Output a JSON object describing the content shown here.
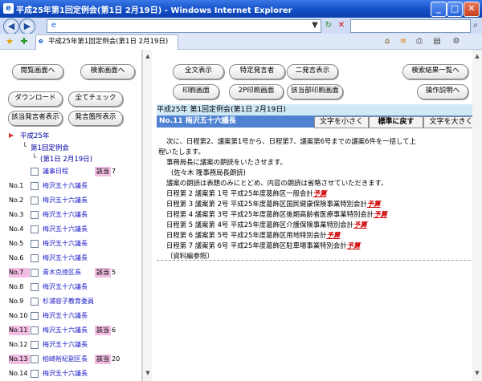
{
  "window": {
    "title": "平成25年第1回定例会(第1日 2月19日) - Windows Internet Explorer"
  },
  "browser": {
    "tab_title": "平成25年第1回定例会(第1日 2月19日)"
  },
  "left": {
    "buttons": {
      "view_screen": "閲覧画面へ",
      "search_screen": "検索画面へ",
      "download": "ダウンロード",
      "check_all": "全てチェック",
      "show_speakers": "該当発言者表示",
      "show_speech_index": "発言箇所表示"
    },
    "tree": {
      "year": "平成25年",
      "session": "第1回定例会",
      "day": "(第1日 2月19日)"
    },
    "agenda": {
      "label": "議事日程",
      "tag": "該当",
      "count": "7"
    },
    "items": [
      {
        "no": "No.1",
        "name": "梅沢五十六議長",
        "tag": "",
        "count": "",
        "hl": false
      },
      {
        "no": "No.2",
        "name": "梅沢五十六議長",
        "tag": "",
        "count": "",
        "hl": false
      },
      {
        "no": "No.3",
        "name": "梅沢五十六議長",
        "tag": "",
        "count": "",
        "hl": false
      },
      {
        "no": "No.4",
        "name": "梅沢五十六議長",
        "tag": "",
        "count": "",
        "hl": false
      },
      {
        "no": "No.5",
        "name": "梅沢五十六議長",
        "tag": "",
        "count": "",
        "hl": false
      },
      {
        "no": "No.6",
        "name": "梅沢五十六議長",
        "tag": "",
        "count": "",
        "hl": false
      },
      {
        "no": "No.7",
        "name": "青木克徳区長",
        "tag": "該当",
        "count": "5",
        "hl": true
      },
      {
        "no": "No.8",
        "name": "梅沢五十六議長",
        "tag": "",
        "count": "",
        "hl": false
      },
      {
        "no": "No.9",
        "name": "杉浦容子教育委員",
        "tag": "",
        "count": "",
        "hl": false
      },
      {
        "no": "No.10",
        "name": "梅沢五十六議長",
        "tag": "",
        "count": "",
        "hl": false
      },
      {
        "no": "No.11",
        "name": "梅沢五十六議長",
        "tag": "該当",
        "count": "6",
        "hl": true
      },
      {
        "no": "No.12",
        "name": "梅沢五十六議長",
        "tag": "",
        "count": "",
        "hl": false
      },
      {
        "no": "No.13",
        "name": "柏崎裕紀副区長",
        "tag": "該当",
        "count": "20",
        "hl": true
      },
      {
        "no": "No.14",
        "name": "梅沢五十六議長",
        "tag": "",
        "count": "",
        "hl": false
      }
    ]
  },
  "right": {
    "buttons": {
      "show_all": "全文表示",
      "specific_speaker": "特定発言者",
      "two_speakers": "二発言表示",
      "search_results": "検索結果一覧へ",
      "print_screen": "印刷画面",
      "print_2p": "2P印刷画面",
      "print_relevant": "該当部印刷画面",
      "help": "操作説明へ"
    },
    "meeting_header": "平成25年 第1回定例会(第1日 2月19日)",
    "speaker": "No.11 梅沢五十六議長",
    "font_buttons": {
      "smaller": "文字を小さく",
      "reset": "標準に戻す",
      "larger": "文字を大きく"
    },
    "lines": [
      "次に、日程第2、議案第1号から、日程第7、議案第6号までの議案6件を一括して上",
      "程いたします。",
      "事務局長に議案の朗読をいたさせます。",
      "(佐々木 隆事務局長朗読)",
      "議案の朗読は表題のみにとどめ、内容の朗読は省略させていただきます。"
    ],
    "bills": [
      {
        "text": "日程第 2 議案第 1号 平成25年度葛飾区一般会計",
        "link": "予算"
      },
      {
        "text": "日程第 3 議案第 2号 平成25年度葛飾区国民健康保険事業特別会計",
        "link": "予算"
      },
      {
        "text": "日程第 4 議案第 3号 平成25年度葛飾区後期高齢者医療事業特別会計",
        "link": "予算"
      },
      {
        "text": "日程第 5 議案第 4号 平成25年度葛飾区介護保険事業特別会計",
        "link": "予算"
      },
      {
        "text": "日程第 6 議案第 5号 平成25年度葛飾区用地特別会計",
        "link": "予算"
      },
      {
        "text": "日程第 7 議案第 6号 平成25年度葛飾区駐車場事業特別会計",
        "link": "予算"
      }
    ],
    "ref": "〔資料編参照〕"
  }
}
